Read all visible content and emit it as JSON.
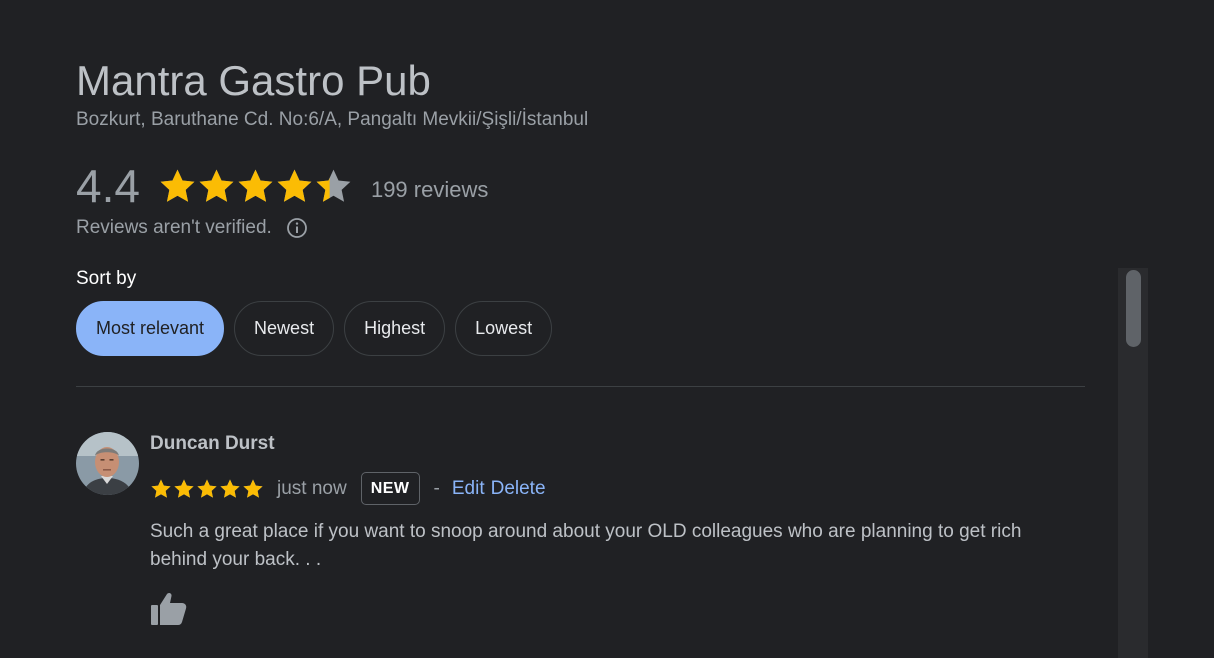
{
  "place": {
    "name": "Mantra Gastro Pub",
    "address": "Bozkurt, Baruthane Cd. No:6/A, Pangaltı Mevkii/Şişli/İstanbul"
  },
  "rating": {
    "value": "4.4",
    "value_numeric": 4.4,
    "max_stars": 5,
    "review_count": "199 reviews",
    "verified_note": "Reviews aren't verified.",
    "info_icon": "info-circle-icon"
  },
  "sort": {
    "label": "Sort by",
    "options": [
      {
        "label": "Most relevant",
        "selected": true
      },
      {
        "label": "Newest",
        "selected": false
      },
      {
        "label": "Highest",
        "selected": false
      },
      {
        "label": "Lowest",
        "selected": false
      }
    ]
  },
  "review": {
    "author": "Duncan Durst",
    "stars": 5,
    "time": "just now",
    "badge": "NEW",
    "separator": "-",
    "edit_label": "Edit",
    "delete_label": "Delete",
    "text": "Such a great place if you want to snoop around about your OLD colleagues who are planning to get rich behind your back. . .",
    "like_icon": "thumbs-up-icon"
  },
  "colors": {
    "background": "#202124",
    "star": "#fbbc04",
    "star_empty": "#9aa0a6",
    "accent": "#8ab4f8",
    "text_primary": "#e8eaed",
    "text_secondary": "#9aa0a6"
  }
}
